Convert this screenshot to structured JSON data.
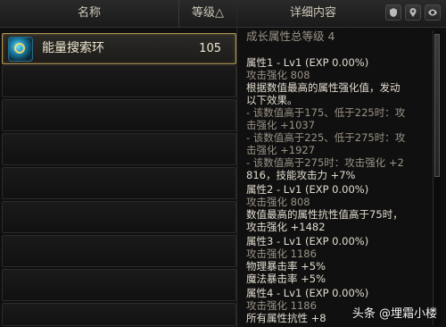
{
  "left_panel": {
    "headers": {
      "name": "名称",
      "level": "等级△"
    },
    "items": [
      {
        "name": "能量搜索环",
        "level": "105",
        "selected": true
      },
      {
        "name": "",
        "level": "",
        "selected": false
      },
      {
        "name": "",
        "level": "",
        "selected": false
      },
      {
        "name": "",
        "level": "",
        "selected": false
      },
      {
        "name": "",
        "level": "",
        "selected": false
      },
      {
        "name": "",
        "level": "",
        "selected": false
      },
      {
        "name": "",
        "level": "",
        "selected": false
      },
      {
        "name": "",
        "level": "",
        "selected": false
      },
      {
        "name": "",
        "level": "",
        "selected": false
      }
    ]
  },
  "right_panel": {
    "title": "详细内容",
    "icons": [
      "shield-icon",
      "map-pin-icon",
      "eye-icon"
    ],
    "summary": "成长属性总等级 4",
    "details": [
      {
        "text": "属性1 - Lv1 (EXP 0.00%)",
        "color": "white"
      },
      {
        "text": "攻击强化 808",
        "color": "muted"
      },
      {
        "text": "根据数值最高的属性强化值，发动",
        "color": "white"
      },
      {
        "text": "以下效果。",
        "color": "white"
      },
      {
        "text": "- 该数值高于175、低于225时：攻",
        "color": "muted"
      },
      {
        "text": "击强化 +1037",
        "color": "muted"
      },
      {
        "text": "- 该数值高于225、低于275时：攻",
        "color": "muted"
      },
      {
        "text": "击强化 +1927",
        "color": "muted"
      },
      {
        "text": "- 该数值高于275时：攻击强化 +2",
        "color": "muted"
      },
      {
        "text": "816，技能攻击力 +7%",
        "color": "white"
      },
      {
        "text": "属性2 - Lv1 (EXP 0.00%)",
        "color": "white"
      },
      {
        "text": "攻击强化 808",
        "color": "muted"
      },
      {
        "text": "数值最高的属性抗性值高于75时，",
        "color": "white"
      },
      {
        "text": "攻击强化 +1482",
        "color": "white"
      },
      {
        "text": "属性3 - Lv1 (EXP 0.00%)",
        "color": "white"
      },
      {
        "text": "攻击强化 1186",
        "color": "muted"
      },
      {
        "text": "物理暴击率 +5%",
        "color": "white"
      },
      {
        "text": "魔法暴击率 +5%",
        "color": "white"
      },
      {
        "text": "属性4 - Lv1 (EXP 0.00%)",
        "color": "white"
      },
      {
        "text": "攻击强化 1186",
        "color": "muted"
      },
      {
        "text": "所有属性抗性 +8",
        "color": "white"
      }
    ]
  },
  "watermark": "头条 @埋霜小楼"
}
